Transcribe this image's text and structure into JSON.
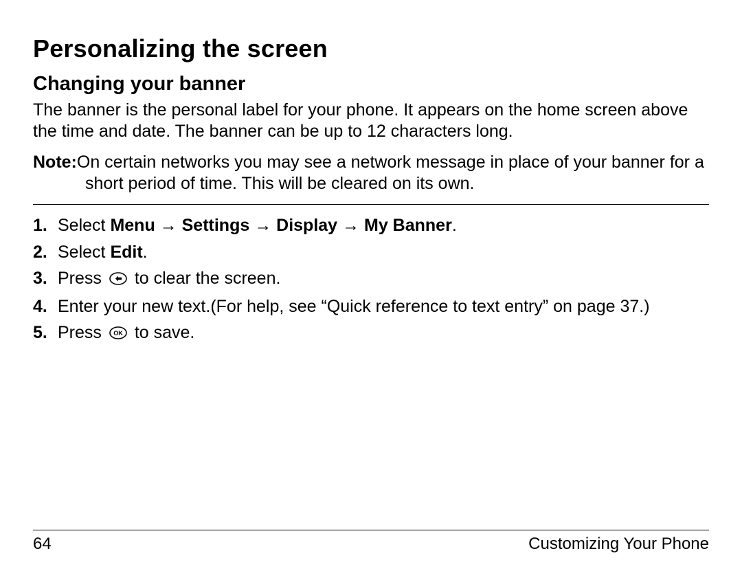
{
  "heading1": "Personalizing the screen",
  "heading2": "Changing your banner",
  "intro": "The banner is the personal label for your phone. It appears on the home screen above the time and date. The banner can be up to 12 characters long.",
  "note": {
    "label": "Note:",
    "text": "On certain networks you may see a network message in place of your banner for a short period of time. This will be cleared on its own."
  },
  "steps": {
    "n1": "1.",
    "n2": "2.",
    "n3": "3.",
    "n4": "4.",
    "n5": "5.",
    "s1_prefix": "Select ",
    "s1_menu": "Menu",
    "s1_arrow": " → ",
    "s1_settings": "Settings",
    "s1_display": "Display",
    "s1_mybanner": "My Banner",
    "s1_period": ".",
    "s2_prefix": "Select ",
    "s2_edit": "Edit",
    "s2_period": ".",
    "s3_prefix": "Press ",
    "s3_suffix": " to clear the screen.",
    "s4_text": "Enter your new text.(For help, see “Quick reference to text entry” on page 37.)",
    "s5_prefix": "Press ",
    "s5_suffix": " to save."
  },
  "footer": {
    "page_number": "64",
    "section": "Customizing Your Phone"
  }
}
